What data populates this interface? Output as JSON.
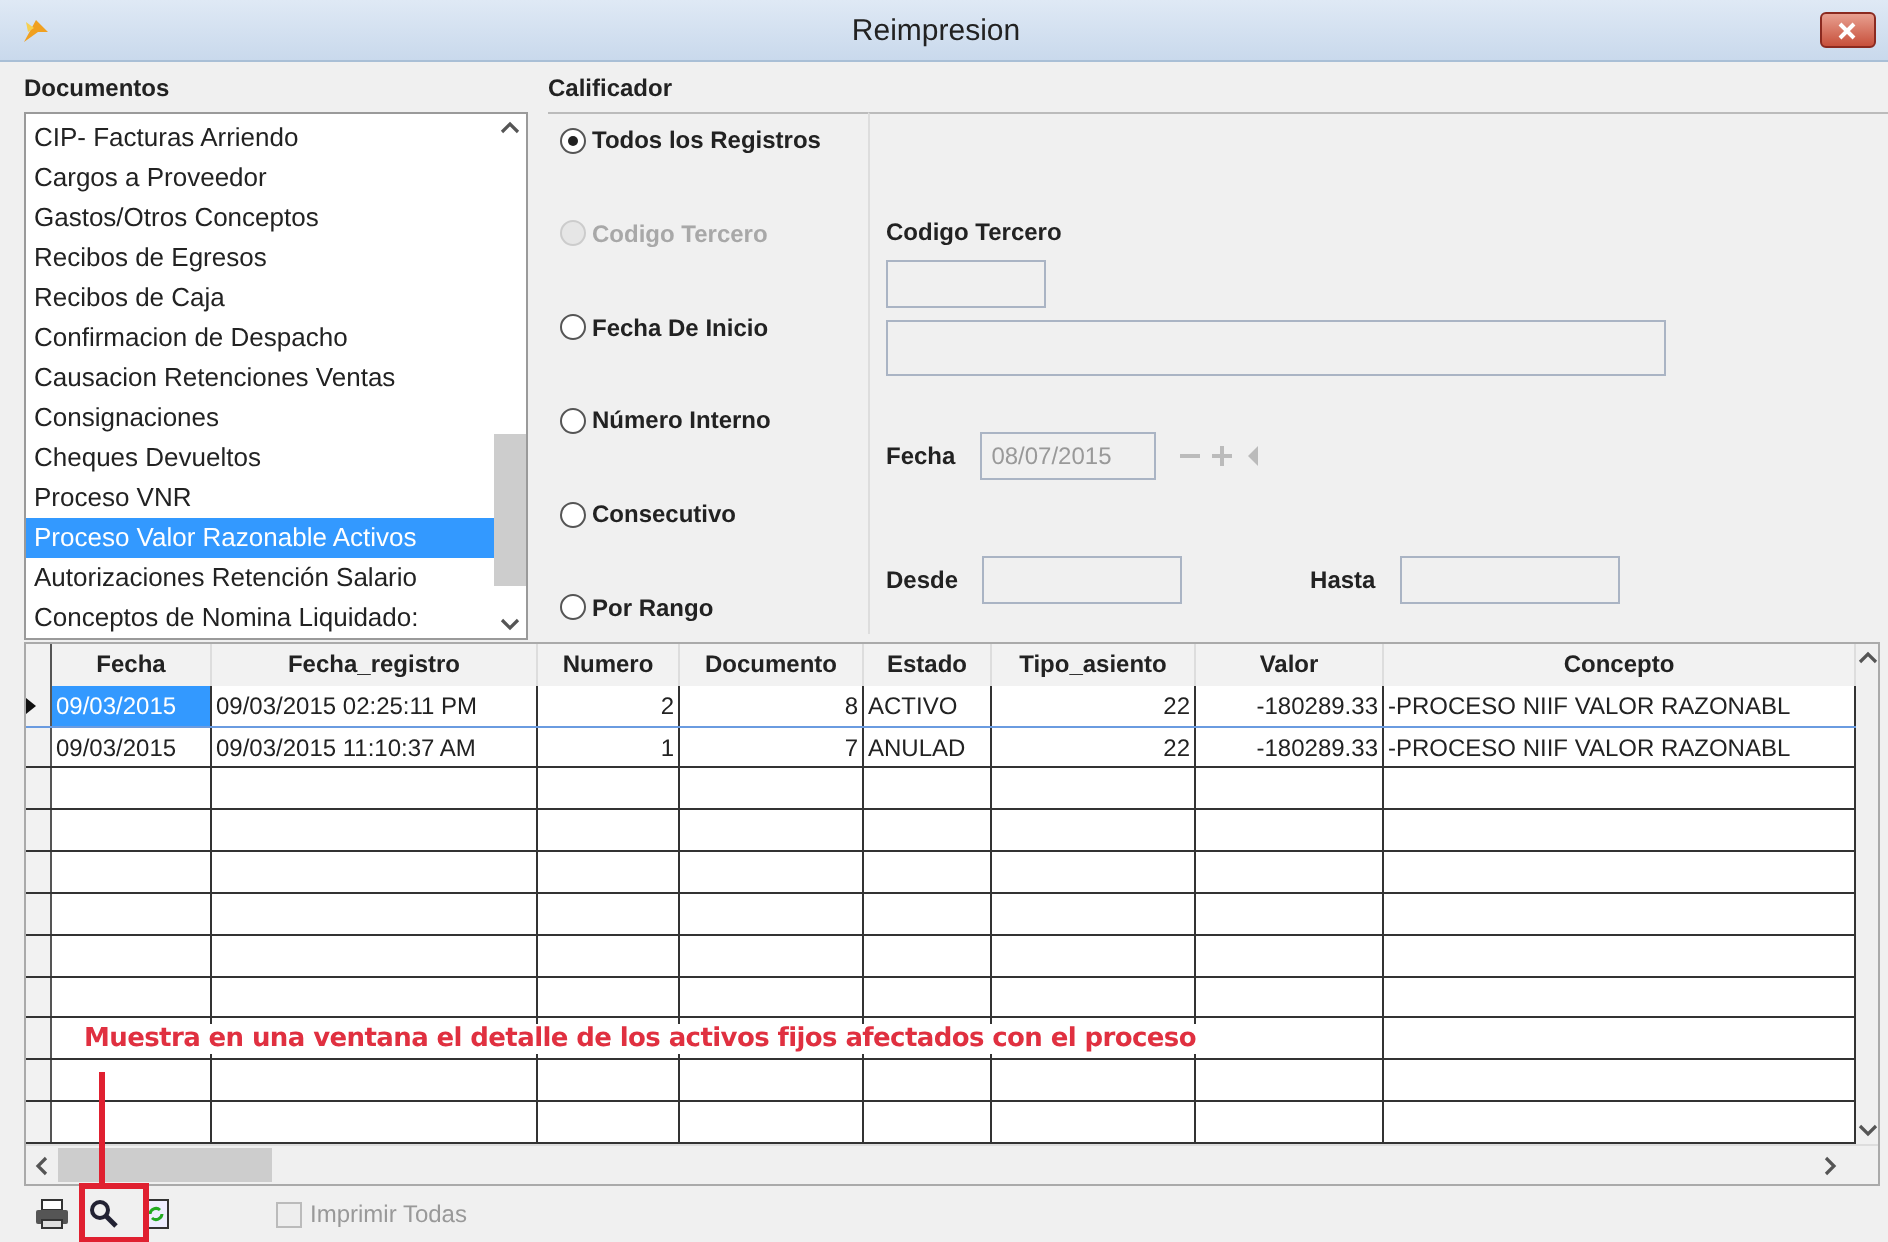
{
  "window": {
    "title": "Reimpresion"
  },
  "documentos": {
    "label": "Documentos",
    "items": [
      {
        "label": "CIP- Facturas Arriendo",
        "selected": false
      },
      {
        "label": "Cargos a Proveedor",
        "selected": false
      },
      {
        "label": "Gastos/Otros Conceptos",
        "selected": false
      },
      {
        "label": "Recibos de Egresos",
        "selected": false
      },
      {
        "label": "Recibos de Caja",
        "selected": false
      },
      {
        "label": "Confirmacion de Despacho",
        "selected": false
      },
      {
        "label": "Causacion Retenciones Ventas",
        "selected": false
      },
      {
        "label": "Consignaciones",
        "selected": false
      },
      {
        "label": "Cheques Devueltos",
        "selected": false
      },
      {
        "label": "Proceso VNR",
        "selected": false
      },
      {
        "label": "Proceso Valor Razonable Activos",
        "selected": true
      },
      {
        "label": "Autorizaciones Retención Salario",
        "selected": false
      },
      {
        "label": "Conceptos de Nomina Liquidado:",
        "selected": false
      }
    ]
  },
  "calificador": {
    "label": "Calificador",
    "options": [
      {
        "label": "Todos los Registros",
        "selected": true,
        "disabled": false
      },
      {
        "label": "Codigo Tercero",
        "selected": false,
        "disabled": true
      },
      {
        "label": "Fecha De Inicio",
        "selected": false,
        "disabled": false
      },
      {
        "label": "Número Interno",
        "selected": false,
        "disabled": false
      },
      {
        "label": "Consecutivo",
        "selected": false,
        "disabled": false
      },
      {
        "label": "Por Rango",
        "selected": false,
        "disabled": false
      }
    ]
  },
  "filtros": {
    "codigo_tercero_label": "Codigo Tercero",
    "fecha_label": "Fecha",
    "fecha_value": "08/07/2015",
    "desde_label": "Desde",
    "hasta_label": "Hasta"
  },
  "table": {
    "columns": [
      "Fecha",
      "Fecha_registro",
      "Numero",
      "Documento",
      "Estado",
      "Tipo_asiento",
      "Valor",
      "Concepto"
    ],
    "rows": [
      {
        "selected": true,
        "cells": [
          "09/03/2015",
          "09/03/2015 02:25:11 PM",
          "2",
          "8",
          "ACTIVO",
          "22",
          "-180289.33",
          "-PROCESO NIIF VALOR RAZONABL"
        ]
      },
      {
        "selected": false,
        "cells": [
          "09/03/2015",
          "09/03/2015 11:10:37 AM",
          "1",
          "7",
          "ANULAD",
          "22",
          "-180289.33",
          "-PROCESO NIIF VALOR RAZONABL"
        ]
      }
    ]
  },
  "toolbar": {
    "imprimir_todas": {
      "label": "Imprimir Todas",
      "checked": false,
      "disabled": true
    }
  },
  "annotation": {
    "text": "Muestra en una ventana el detalle de los activos fijos afectados con el proceso"
  }
}
